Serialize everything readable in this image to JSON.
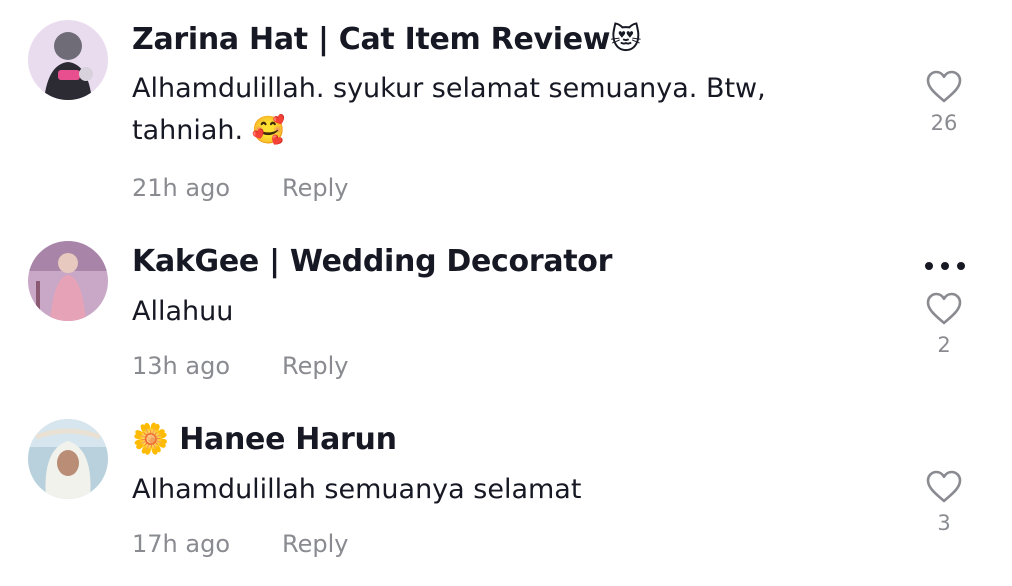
{
  "comments": [
    {
      "username": "Zarina Hat | Cat Item Review",
      "username_emoji": "😻",
      "text": "Alhamdulillah. syukur selamat semuanya. Btw, tahniah.",
      "text_emoji": "🥰",
      "time": "21h ago",
      "reply_label": "Reply",
      "like_count": "26",
      "avatar_icon": "avatar-person-holding-cat-icon"
    },
    {
      "username": "KakGee | Wedding Decorator",
      "text": "Allahuu",
      "time": "13h ago",
      "reply_label": "Reply",
      "like_count": "2",
      "more_icon": "more-options-icon",
      "avatar_icon": "avatar-woman-pink-dress-icon"
    },
    {
      "username_emoji": "🌼",
      "username": "Hanee Harun",
      "text": "Alhamdulillah semuanya selamat",
      "time": "17h ago",
      "reply_label": "Reply",
      "like_count": "3",
      "avatar_icon": "avatar-woman-hijab-icon"
    }
  ],
  "colors": {
    "primary_text": "#161823",
    "secondary_text": "#8a8b91",
    "background": "#ffffff"
  }
}
